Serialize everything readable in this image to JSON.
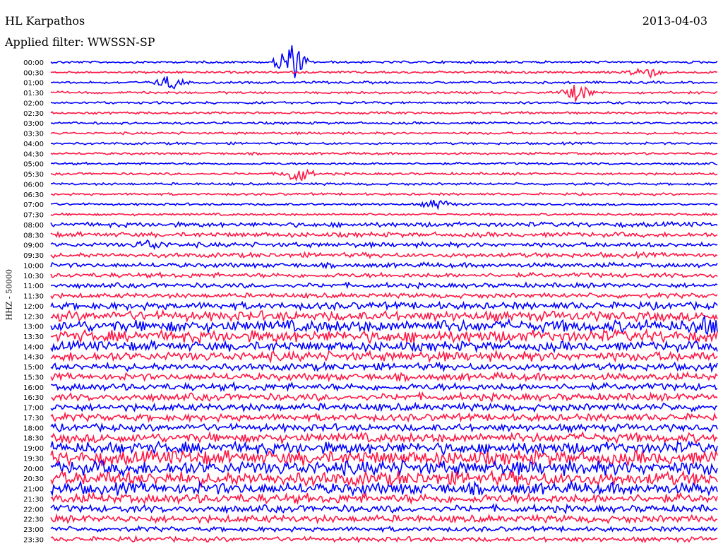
{
  "header": {
    "station": "HL Karpathos",
    "date": "2013-04-03",
    "filter": "Applied filter: WWSSN-SP"
  },
  "chart_data": {
    "type": "line",
    "title": "HL Karpathos",
    "ylabel": "HHZ - 50000",
    "time_labels": [
      "00:00",
      "00:30",
      "01:00",
      "01:30",
      "02:00",
      "02:30",
      "03:00",
      "03:30",
      "04:00",
      "04:30",
      "05:00",
      "05:30",
      "06:00",
      "06:30",
      "07:00",
      "07:30",
      "08:00",
      "08:30",
      "09:00",
      "09:30",
      "10:00",
      "10:30",
      "11:00",
      "11:30",
      "12:00",
      "12:30",
      "13:00",
      "13:30",
      "14:00",
      "14:30",
      "15:00",
      "15:30",
      "16:00",
      "16:30",
      "17:00",
      "17:30",
      "18:00",
      "18:30",
      "19:00",
      "19:30",
      "20:00",
      "20:30",
      "21:00",
      "21:30",
      "22:00",
      "22:30",
      "23:00",
      "23:30"
    ],
    "colors": [
      "#0000ff",
      "#ff1744"
    ],
    "trace_amplitude": [
      1,
      1,
      1,
      1,
      1,
      1,
      1,
      1,
      1,
      1,
      1,
      1,
      1,
      1,
      1,
      1,
      2,
      2,
      2,
      2,
      2,
      2,
      2,
      2,
      3,
      4,
      5,
      5,
      4,
      4,
      3,
      3,
      3,
      3,
      3,
      3,
      3,
      4,
      5,
      6,
      6,
      6,
      5,
      4,
      3,
      3,
      2,
      2
    ],
    "events": [
      {
        "row": 0,
        "x": 0.36,
        "amp": 9
      },
      {
        "row": 2,
        "x": 0.18,
        "amp": 3
      },
      {
        "row": 3,
        "x": 0.79,
        "amp": 4
      },
      {
        "row": 1,
        "x": 0.89,
        "amp": 3
      },
      {
        "row": 11,
        "x": 0.37,
        "amp": 4
      },
      {
        "row": 14,
        "x": 0.58,
        "amp": 2
      },
      {
        "row": 18,
        "x": 0.15,
        "amp": 2
      },
      {
        "row": 26,
        "x": 0.98,
        "amp": 3
      }
    ]
  }
}
